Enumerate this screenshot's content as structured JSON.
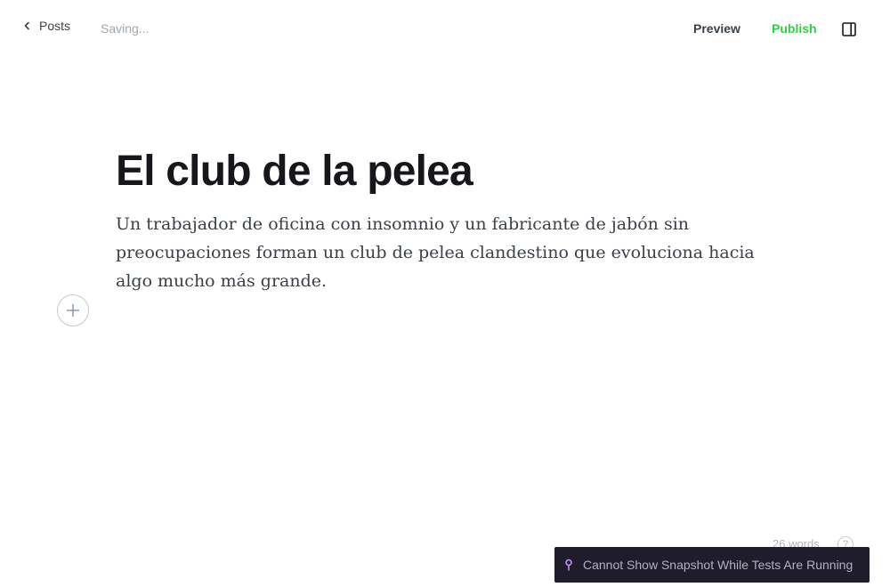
{
  "topbar": {
    "back_label": "Posts",
    "status": "Saving...",
    "preview_label": "Preview",
    "publish_label": "Publish"
  },
  "editor": {
    "title": "El club de la pelea",
    "excerpt": "Un trabajador de oficina con insomnio y un fabricante de jabón sin preocupaciones forman un club de pelea clandestino que evoluciona hacia algo mucho más grande."
  },
  "footer": {
    "word_count": "26 words",
    "help_symbol": "?"
  },
  "snapshot_banner": {
    "message": "Cannot Show Snapshot While Tests Are Running"
  },
  "colors": {
    "publish": "#30cf43",
    "banner_bg": "#1f1d2b",
    "banner_text": "#aeb2c6",
    "pin": "#c58dff"
  },
  "icons": {
    "back": "chevron-left-icon",
    "sidebar_toggle": "sidebar-panel-icon",
    "add_card": "plus-icon",
    "help": "question-circle-icon",
    "banner": "pin-icon"
  }
}
